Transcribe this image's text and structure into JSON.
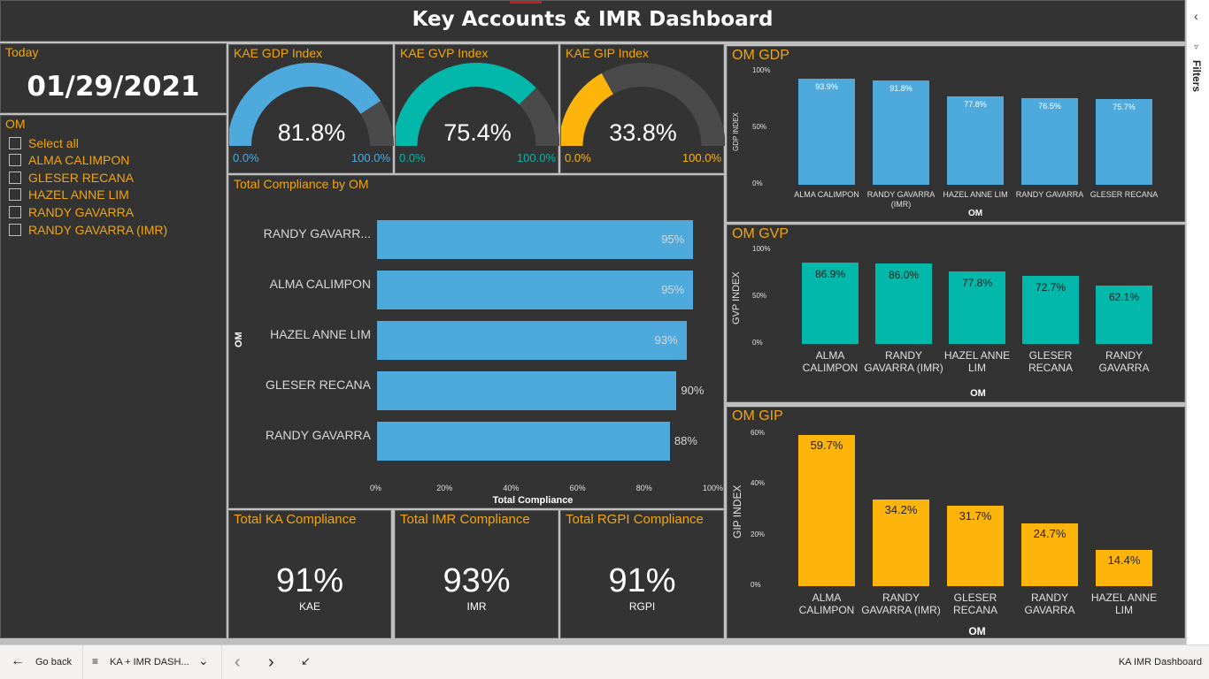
{
  "header": {
    "title": "Key Accounts & IMR Dashboard"
  },
  "today": {
    "title": "Today",
    "date": "01/29/2021"
  },
  "slicer": {
    "title": "OM",
    "items": [
      {
        "label": "Select all"
      },
      {
        "label": "ALMA CALIMPON"
      },
      {
        "label": "GLESER RECANA"
      },
      {
        "label": "HAZEL ANNE LIM"
      },
      {
        "label": "RANDY GAVARRA"
      },
      {
        "label": "RANDY GAVARRA (IMR)"
      }
    ]
  },
  "gauges": [
    {
      "title": "KAE GDP Index",
      "value": "81.8%",
      "fraction": 0.818,
      "min": "0.0%",
      "max": "100.0%",
      "color": "#4ea9dc"
    },
    {
      "title": "KAE GVP Index",
      "value": "75.4%",
      "fraction": 0.754,
      "min": "0.0%",
      "max": "100.0%",
      "color": "#01b8aa"
    },
    {
      "title": "KAE GIP Index",
      "value": "33.8%",
      "fraction": 0.338,
      "min": "0.0%",
      "max": "100.0%",
      "color": "#fdb40b"
    }
  ],
  "compliance": {
    "title": "Total Compliance by OM",
    "ylabel": "OM",
    "xlabel": "Total Compliance",
    "xticks": [
      "0%",
      "20%",
      "40%",
      "60%",
      "80%",
      "100%"
    ],
    "bars": [
      {
        "name": "RANDY GAVARR...",
        "label": "95%"
      },
      {
        "name": "ALMA CALIMPON",
        "label": "95%"
      },
      {
        "name": "HAZEL ANNE LIM",
        "label": "93%"
      },
      {
        "name": "GLESER RECANA",
        "label": "90%"
      },
      {
        "name": "RANDY GAVARRA",
        "label": "88%"
      }
    ]
  },
  "kpis": [
    {
      "title": "Total KA Compliance",
      "value": "91%",
      "sub": "KAE"
    },
    {
      "title": "Total IMR Compliance",
      "value": "93%",
      "sub": "IMR"
    },
    {
      "title": "Total RGPI Compliance",
      "value": "91%",
      "sub": "RGPI"
    }
  ],
  "om_gdp": {
    "title": "OM GDP",
    "ylabel": "GDP INDEX",
    "xlabel": "OM",
    "yticks": [
      "100%",
      "50%",
      "0%"
    ],
    "color": "#4ea9dc",
    "labels": [
      "93.9%",
      "91.8%",
      "77.8%",
      "76.5%",
      "75.7%"
    ],
    "cats": [
      "ALMA CALIMPON",
      "RANDY GAVARRA (IMR)",
      "HAZEL ANNE LIM",
      "RANDY GAVARRA",
      "GLESER RECANA"
    ]
  },
  "om_gvp": {
    "title": "OM GVP",
    "ylabel": "GVP INDEX",
    "xlabel": "OM",
    "yticks": [
      "100%",
      "50%",
      "0%"
    ],
    "color": "#01b8aa",
    "labels": [
      "86.9%",
      "86.0%",
      "77.8%",
      "72.7%",
      "62.1%"
    ],
    "cats": [
      "ALMA CALIMPON",
      "RANDY GAVARRA (IMR)",
      "HAZEL ANNE LIM",
      "GLESER RECANA",
      "RANDY GAVARRA"
    ]
  },
  "om_gip": {
    "title": "OM GIP",
    "ylabel": "GIP INDEX",
    "xlabel": "OM",
    "yticks": [
      "60%",
      "40%",
      "20%",
      "0%"
    ],
    "color": "#fdb40b",
    "labels": [
      "59.7%",
      "34.2%",
      "31.7%",
      "24.7%",
      "14.4%"
    ],
    "cats": [
      "ALMA CALIMPON",
      "RANDY GAVARRA (IMR)",
      "GLESER RECANA",
      "RANDY GAVARRA",
      "HAZEL ANNE LIM"
    ]
  },
  "chart_data": [
    {
      "type": "bar",
      "title": "Total Compliance by OM",
      "orientation": "horizontal",
      "xlabel": "Total Compliance",
      "ylabel": "OM",
      "xlim": [
        0,
        100
      ],
      "categories": [
        "RANDY GAVARR...",
        "ALMA CALIMPON",
        "HAZEL ANNE LIM",
        "GLESER RECANA",
        "RANDY GAVARRA"
      ],
      "values": [
        95,
        95,
        93,
        90,
        88
      ]
    },
    {
      "type": "bar",
      "title": "OM GDP",
      "xlabel": "OM",
      "ylabel": "GDP INDEX",
      "ylim": [
        0,
        100
      ],
      "categories": [
        "ALMA CALIMPON",
        "RANDY GAVARRA (IMR)",
        "HAZEL ANNE LIM",
        "RANDY GAVARRA",
        "GLESER RECANA"
      ],
      "values": [
        93.9,
        91.8,
        77.8,
        76.5,
        75.7
      ]
    },
    {
      "type": "bar",
      "title": "OM GVP",
      "xlabel": "OM",
      "ylabel": "GVP INDEX",
      "ylim": [
        0,
        100
      ],
      "categories": [
        "ALMA CALIMPON",
        "RANDY GAVARRA (IMR)",
        "HAZEL ANNE LIM",
        "GLESER RECANA",
        "RANDY GAVARRA"
      ],
      "values": [
        86.9,
        86.0,
        77.8,
        72.7,
        62.1
      ]
    },
    {
      "type": "bar",
      "title": "OM GIP",
      "xlabel": "OM",
      "ylabel": "GIP INDEX",
      "ylim": [
        0,
        60
      ],
      "categories": [
        "ALMA CALIMPON",
        "RANDY GAVARRA (IMR)",
        "GLESER RECANA",
        "RANDY GAVARRA",
        "HAZEL ANNE LIM"
      ],
      "values": [
        59.7,
        34.2,
        31.7,
        24.7,
        14.4
      ]
    }
  ],
  "filters": {
    "label": "Filters"
  },
  "footer": {
    "back": "Go back",
    "page": "KA + IMR DASH...",
    "report": "KA IMR Dashboard"
  }
}
